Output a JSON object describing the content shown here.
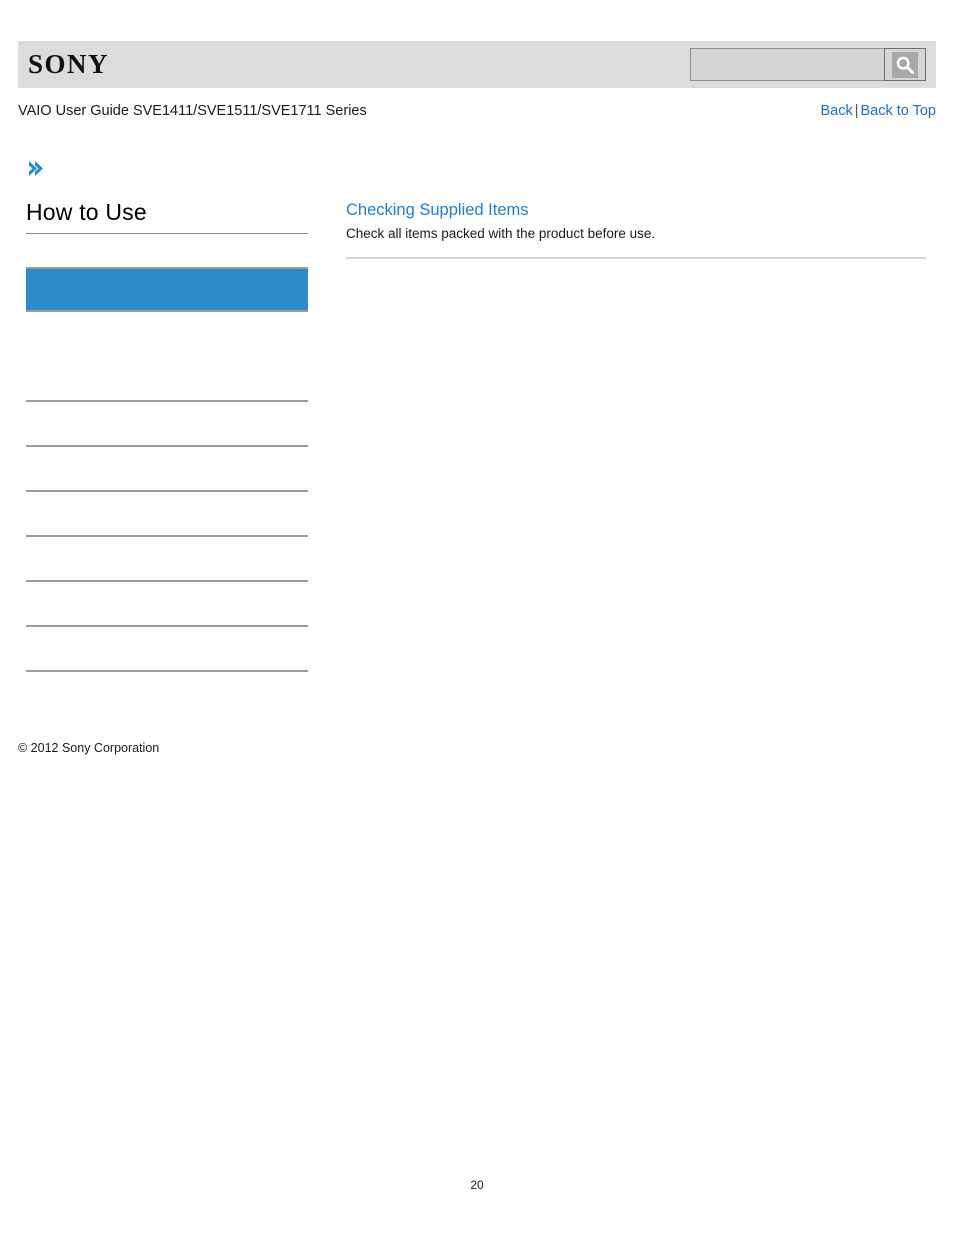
{
  "header": {
    "logo_text": "SONY",
    "logo_icon": "sony-wordmark",
    "search": {
      "value": "",
      "placeholder": "",
      "icon": "search-icon"
    }
  },
  "title_row": {
    "guide_title": "VAIO User Guide SVE1411/SVE1511/SVE1711 Series",
    "back_label": "Back",
    "separator": "|",
    "back_to_top_label": "Back to Top"
  },
  "sidebar": {
    "chevron_icon": "double-chevron-right-icon",
    "heading": "How to Use",
    "items": [
      {
        "label": "",
        "active": true
      },
      {
        "label": "",
        "active": false
      },
      {
        "label": "",
        "active": false
      },
      {
        "label": "",
        "active": false
      },
      {
        "label": "",
        "active": false
      },
      {
        "label": "",
        "active": false
      },
      {
        "label": "",
        "active": false
      },
      {
        "label": "",
        "active": false
      }
    ],
    "copyright": "© 2012 Sony Corporation"
  },
  "content": {
    "articles": [
      {
        "title": "Checking Supplied Items",
        "description": "Check all items packed with the product before use."
      }
    ]
  },
  "footer": {
    "page_number": "20"
  },
  "colors": {
    "header_bar_bg": "#dcdcdc",
    "link_blue": "#1d6fc4",
    "article_title_blue": "#1d7fd4",
    "active_item_blue": "#2c8bc9",
    "chevron_blue": "#2c8bc9",
    "separator_gray": "#9b9b9b"
  }
}
